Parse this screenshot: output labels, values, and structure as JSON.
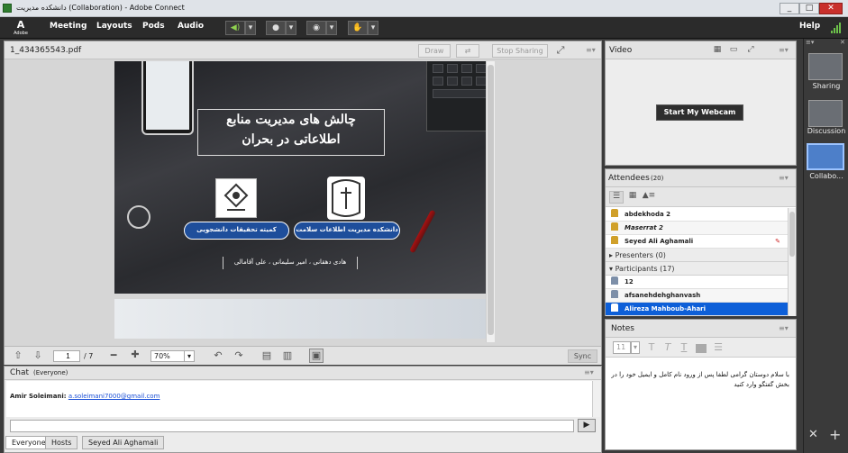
{
  "window": {
    "title": "دانشکده مدیریت (Collaboration) - Adobe Connect",
    "controls": [
      "_",
      "□",
      "✕"
    ]
  },
  "menubar": {
    "logo_text": "Adobe",
    "items": [
      "Meeting",
      "Layouts",
      "Pods",
      "Audio"
    ],
    "help": "Help"
  },
  "share_pod": {
    "filename": "1_434365543.pdf",
    "draw_label": "Draw",
    "stop_sharing_label": "Stop Sharing",
    "page_current": "1",
    "page_total": "/ 7",
    "zoom": "70%",
    "sync_label": "Sync",
    "slide": {
      "title_line1": "چالش های مدیریت منابع",
      "title_line2": "اطلاعاتی در بحران",
      "left_button": "کمیته تحقیقات دانشجویی",
      "right_button": "دانشکده مدیریت اطلاعات سلامت",
      "authors": "هادی دهقانی ، امیر سلیمانی ، علی آقامالی"
    }
  },
  "video_pod": {
    "title": "Video",
    "start_webcam_label": "Start My Webcam"
  },
  "attendees_pod": {
    "title": "Attendees",
    "count": "(20)",
    "hosts": [
      {
        "name": "abdekhoda 2",
        "italic": false
      },
      {
        "name": "Maserrat 2",
        "italic": true
      },
      {
        "name": "Seyed Ali Aghamali",
        "italic": false
      }
    ],
    "presenters_label": "Presenters (0)",
    "participants_label": "Participants (17)",
    "participants": [
      {
        "name": "12",
        "selected": false
      },
      {
        "name": "afsanehdehghanvash",
        "selected": false
      },
      {
        "name": "Alireza Mahboub-Ahari",
        "selected": true
      }
    ]
  },
  "notes_pod": {
    "title": "Notes",
    "font_size": "11",
    "text": "با سلام دوستان گرامی لطفا پس از ورود نام کامل و ایمیل خود را در بخش گفتگو وارد کنید"
  },
  "chat_pod": {
    "title": "Chat",
    "scope": "(Everyone)",
    "message_sender": "Amir Soleimani:",
    "message_link": "a.soleimani7000@gmail.com",
    "input_value": "",
    "tabs": [
      "Everyone",
      "Hosts",
      "Seyed Ali Aghamali"
    ]
  },
  "layouts_sidebar": {
    "items": [
      {
        "label": "Sharing",
        "active": false
      },
      {
        "label": "Discussion",
        "active": false
      },
      {
        "label": "Collabo...",
        "active": true
      }
    ]
  },
  "colors": {
    "accent": "#0d5fd8",
    "slide_button": "#1e4e9b",
    "close_button": "#c9302c"
  }
}
